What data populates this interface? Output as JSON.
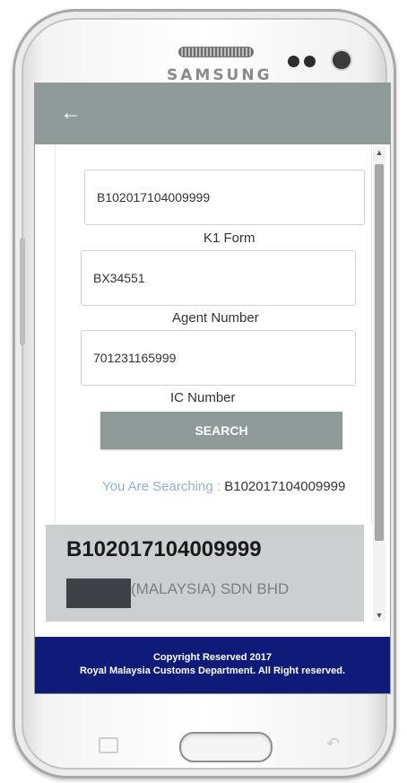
{
  "device": {
    "brand": "SAMSUNG"
  },
  "app_bar": {
    "back_icon": "arrow-left-icon"
  },
  "form": {
    "fields": [
      {
        "value": "B102017104009999",
        "label": "K1 Form"
      },
      {
        "value": "BX34551",
        "label": "Agent Number"
      },
      {
        "value": "701231165999",
        "label": "IC Number"
      }
    ],
    "search_button": "SEARCH"
  },
  "search_status": {
    "prefix": "You Are Searching :",
    "value": "B102017104009999"
  },
  "result": {
    "id": "B102017104009999",
    "name": "(MALAYSIA) SDN BHD"
  },
  "footer": {
    "line1": "Copyright Reserved 2017",
    "line2": "Royal Malaysia Customs Department. All Right reserved."
  },
  "colors": {
    "app_bar": "#8e9b98",
    "footer": "#0e1b78",
    "search_prefix": "#8fb3d4"
  }
}
